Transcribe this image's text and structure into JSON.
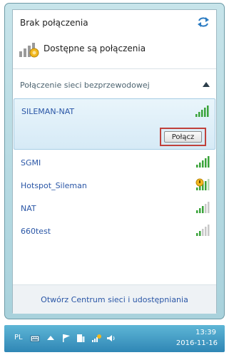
{
  "panel": {
    "status_title": "Brak połączenia",
    "available_label": "Dostępne są połączenia",
    "section_label": "Połączenie sieci bezprzewodowej",
    "selected_network": {
      "name": "SILEMAN-NAT",
      "connect_label": "Połącz",
      "signal_bars": 5
    },
    "networks": [
      {
        "name": "SGMI",
        "signal_bars": 5,
        "secured": false
      },
      {
        "name": "Hotspot_Sileman",
        "signal_bars": 4,
        "secured": true
      },
      {
        "name": "NAT",
        "signal_bars": 3,
        "secured": false
      },
      {
        "name": "660test",
        "signal_bars": 2,
        "secured": false
      }
    ],
    "footer_link": "Otwórz Centrum sieci i udostępniania"
  },
  "taskbar": {
    "language": "PL",
    "time": "13:39",
    "date": "2016-11-16"
  },
  "colors": {
    "link": "#2a56a6",
    "signal_green": "#3aa33a",
    "highlight_border": "#c0413b",
    "taskbar": "#3e95c2"
  }
}
